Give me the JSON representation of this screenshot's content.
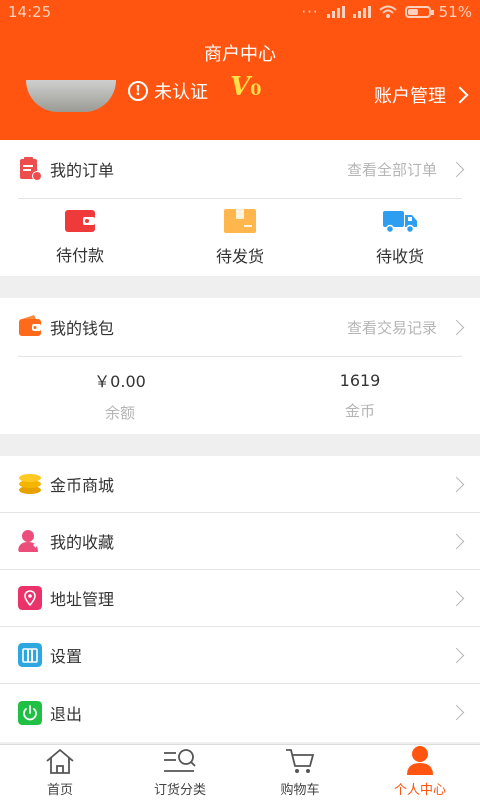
{
  "status": {
    "time": "14:25",
    "battery": "51%",
    "battery_level": 0.51
  },
  "header": {
    "title": "商户中心",
    "verify_text": "未认证",
    "level_prefix": "V",
    "level_value": "0",
    "account_label": "账户管理"
  },
  "orders": {
    "label": "我的订单",
    "more": "查看全部订单",
    "items": [
      {
        "label": "待付款",
        "icon": "wallet-icon"
      },
      {
        "label": "待发货",
        "icon": "box-icon"
      },
      {
        "label": "待收货",
        "icon": "truck-icon"
      }
    ]
  },
  "wallet": {
    "label": "我的钱包",
    "more": "查看交易记录",
    "balance_value": "￥0.00",
    "balance_label": "余额",
    "coins_value": "1619",
    "coins_label": "金币"
  },
  "menu": [
    {
      "label": "金币商城",
      "icon": "coins-icon",
      "color": "#f5b400"
    },
    {
      "label": "我的收藏",
      "icon": "favorite-user-icon",
      "color": "#ec4e7b"
    },
    {
      "label": "地址管理",
      "icon": "location-icon",
      "color": "#e9336a"
    },
    {
      "label": "设置",
      "icon": "settings-icon",
      "color": "#2ea7e0"
    },
    {
      "label": "退出",
      "icon": "power-icon",
      "color": "#1fc043"
    }
  ],
  "tabs": [
    {
      "label": "首页",
      "icon": "home-icon"
    },
    {
      "label": "订货分类",
      "icon": "category-search-icon"
    },
    {
      "label": "购物车",
      "icon": "cart-icon"
    },
    {
      "label": "个人中心",
      "icon": "user-icon"
    }
  ],
  "colors": {
    "brand": "#ff5511",
    "muted": "#b5b5b5",
    "level": "#ffe04a"
  }
}
